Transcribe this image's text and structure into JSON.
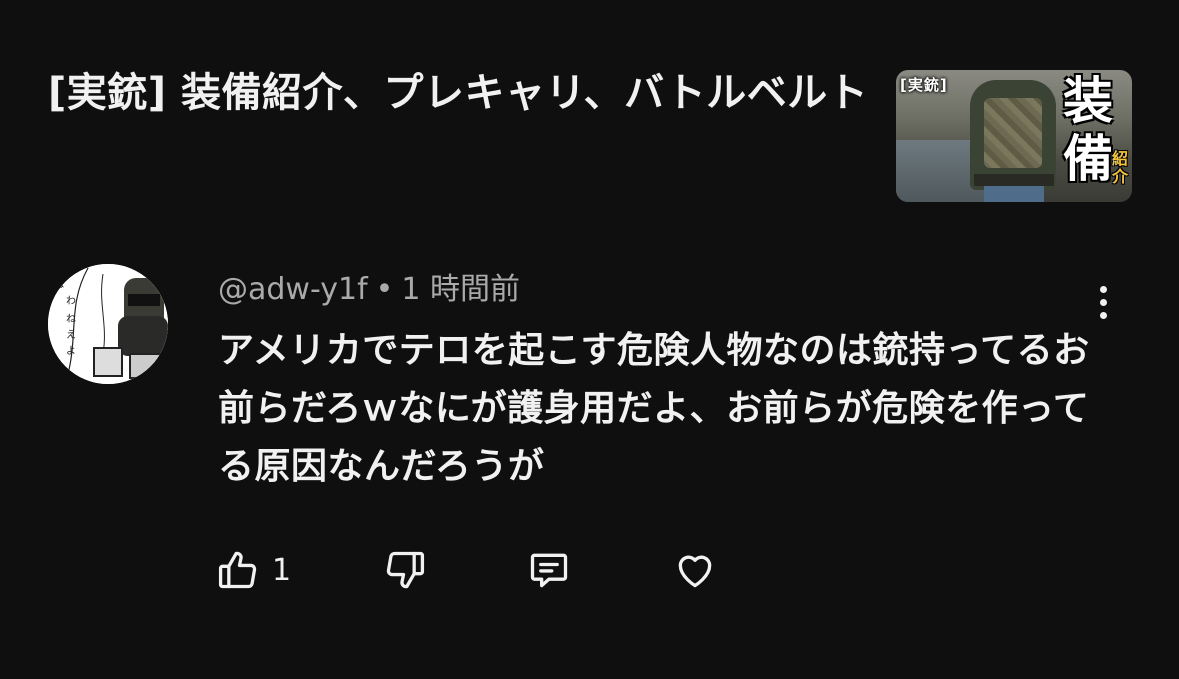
{
  "video": {
    "title": "[実銃] 装備紹介、プレキャリ、バトルベルト",
    "thumbnail": {
      "tag": "[実銃]",
      "big_text": "装備",
      "small_text": "紹介",
      "accent_color": "#f2c43b"
    }
  },
  "comment": {
    "author": "@adw-y1f",
    "separator": "•",
    "time": "1 時間前",
    "text": "アメリカでテロを起こす危険人物なのは銃持ってるお前らだろｗなにが護身用だよ、お前らが危険を作ってる原因なんだろうが",
    "avatar_icon": "avatar-image",
    "more_icon": "more-vert-icon",
    "likes": "1",
    "actions": {
      "like_icon": "thumb-up-icon",
      "dislike_icon": "thumb-down-icon",
      "reply_icon": "reply-icon",
      "heart_icon": "heart-icon"
    }
  },
  "colors": {
    "background": "#0f0f0f",
    "text_primary": "#f1f1f1",
    "text_secondary": "#aaaaaa"
  }
}
